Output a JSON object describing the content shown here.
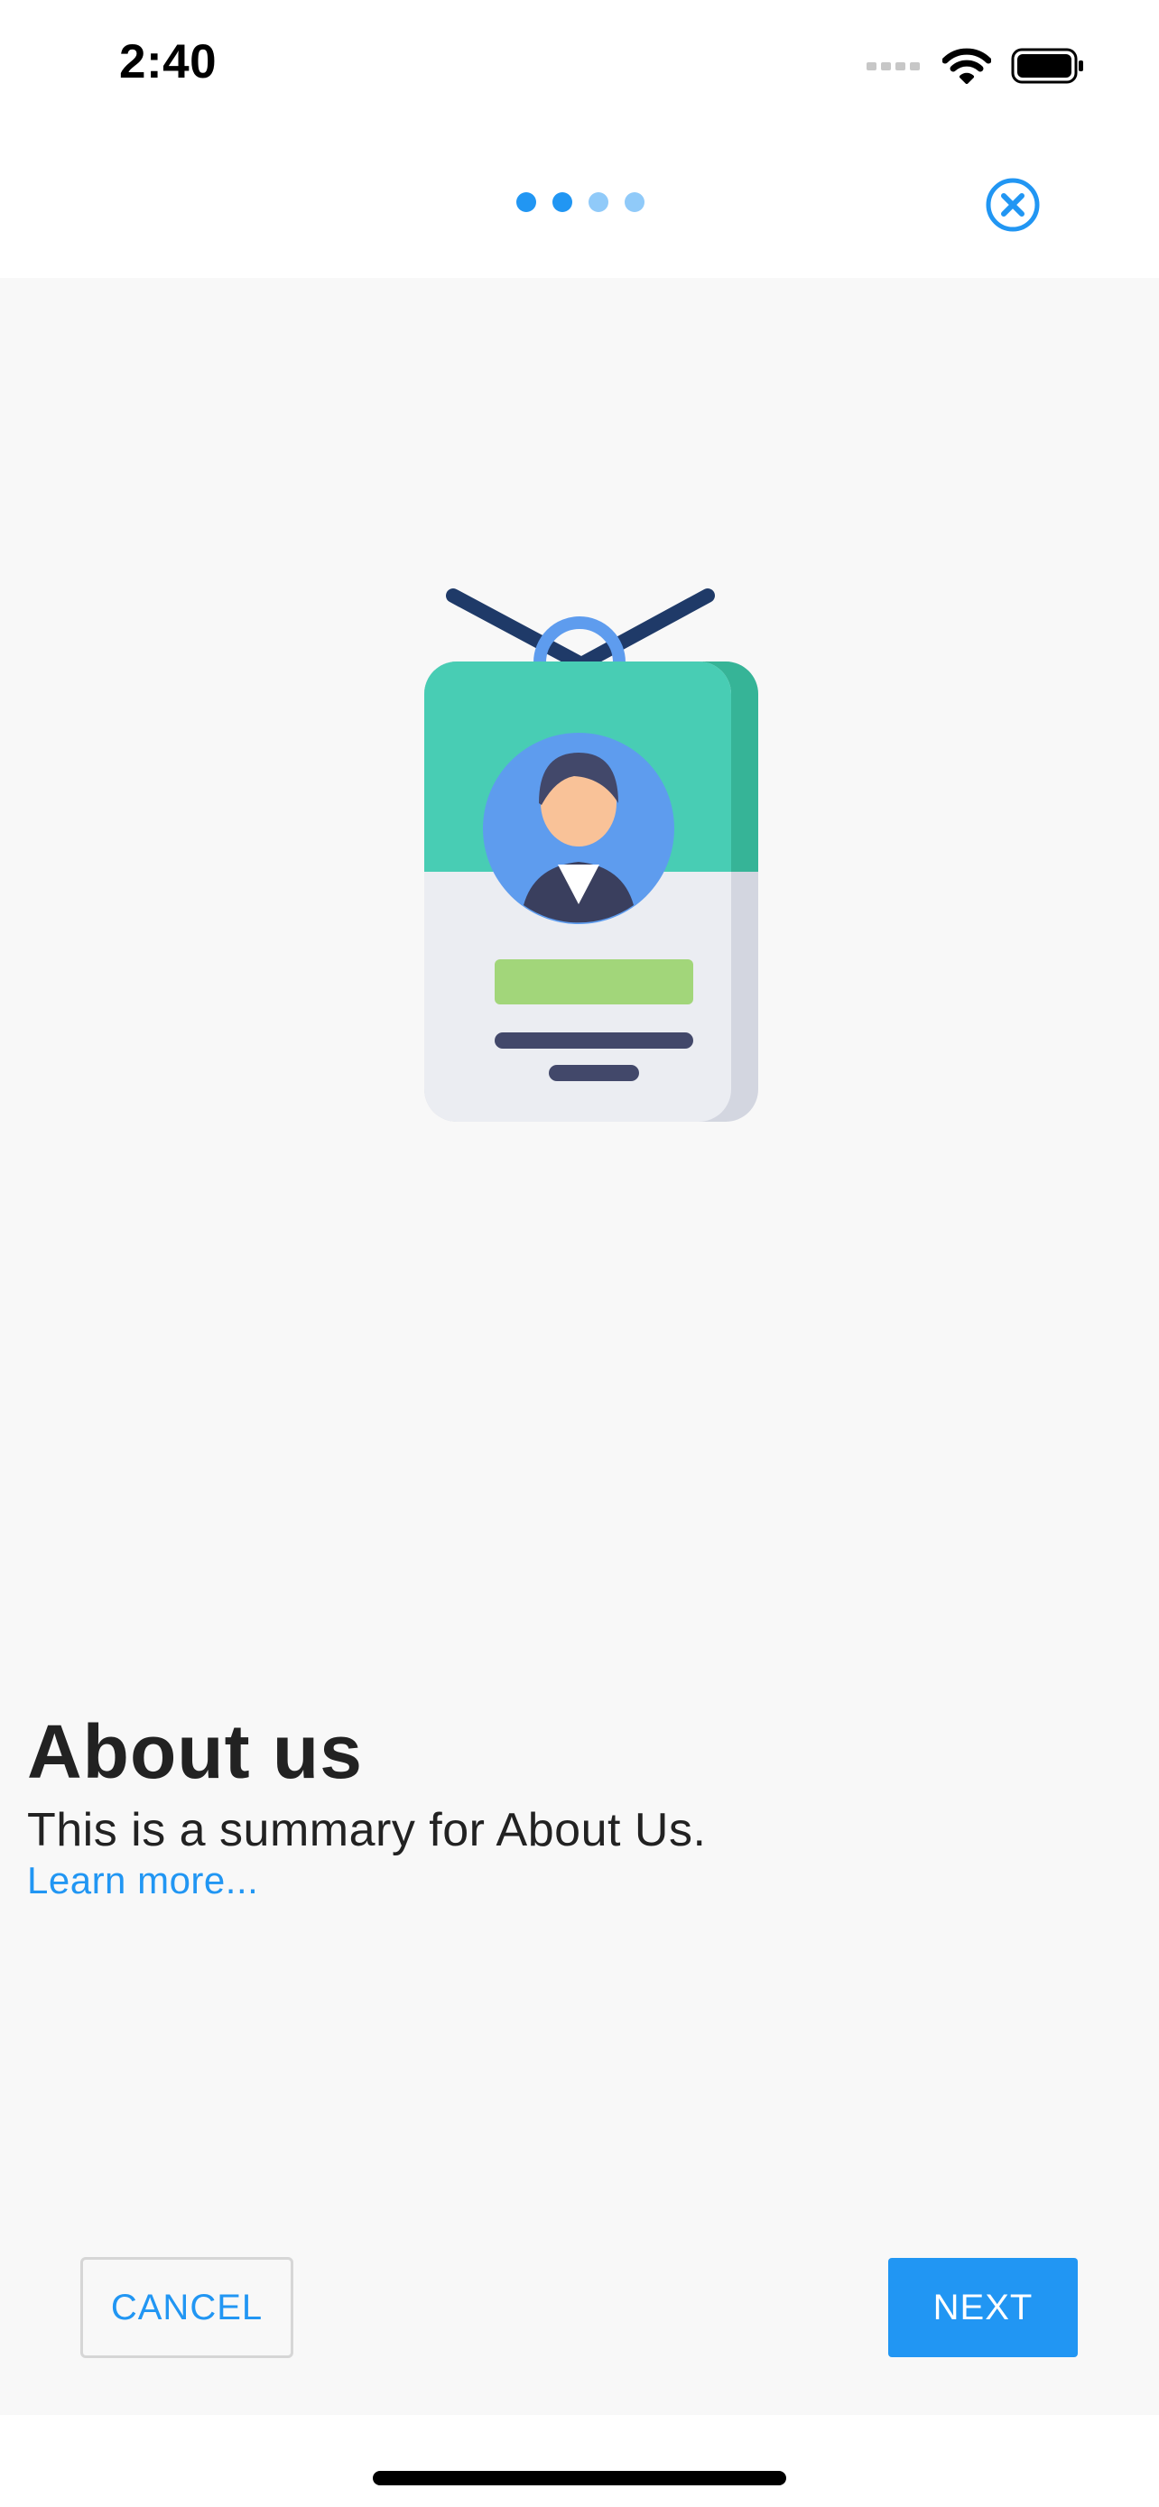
{
  "status_bar": {
    "time": "2:40"
  },
  "header": {
    "pager": {
      "total": 4,
      "current": 2
    },
    "close_icon": "close-circle-icon"
  },
  "main": {
    "illustration_icon": "id-badge-icon",
    "title": "About us",
    "summary": "This is a summary for About Us.",
    "learn_more": "Learn more..."
  },
  "actions": {
    "cancel_label": "CANCEL",
    "next_label": "NEXT"
  },
  "colors": {
    "accent": "#2196F3",
    "dot_active": "#2196F3",
    "dot_inactive": "#90CAF9",
    "content_background": "#F8F8F8"
  }
}
